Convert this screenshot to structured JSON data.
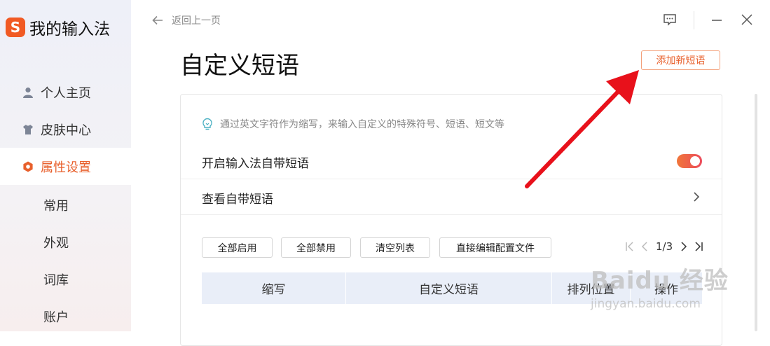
{
  "app": {
    "logo_letter": "S",
    "title": "我的输入法"
  },
  "sidebar": {
    "items": [
      {
        "label": "个人主页",
        "icon": "user-icon"
      },
      {
        "label": "皮肤中心",
        "icon": "shirt-icon"
      },
      {
        "label": "属性设置",
        "icon": "hexagon-settings-icon",
        "active": true
      }
    ],
    "sub_items": [
      {
        "label": "常用"
      },
      {
        "label": "外观"
      },
      {
        "label": "词库"
      },
      {
        "label": "账户"
      }
    ]
  },
  "header": {
    "back_label": "返回上一页"
  },
  "page": {
    "title": "自定义短语",
    "add_button": "添加新短语"
  },
  "card": {
    "hint": "通过英文字符作为缩写，来输入自定义的特殊符号、短语、短文等",
    "toggle_label": "开启输入法自带短语",
    "toggle_on": true,
    "view_label": "查看自带短语"
  },
  "toolbar": {
    "enable_all": "全部启用",
    "disable_all": "全部禁用",
    "clear_list": "清空列表",
    "edit_config": "直接编辑配置文件"
  },
  "pager": {
    "page_text": "1/3"
  },
  "table": {
    "columns": [
      "缩写",
      "自定义短语",
      "排列位置",
      "操作"
    ]
  },
  "watermark": {
    "brand": "Baidu 经验",
    "url": "jingyan.baidu.com"
  },
  "colors": {
    "accent": "#e8602c",
    "toggle": "#ef5a4a",
    "annotation_arrow": "#e8111b"
  }
}
